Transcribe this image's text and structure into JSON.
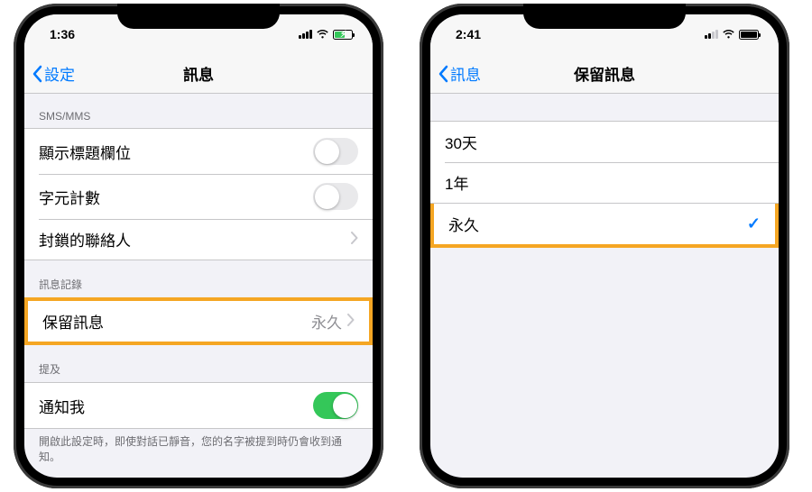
{
  "left": {
    "status_time": "1:36",
    "nav_back": "設定",
    "nav_title": "訊息",
    "sec1_header": "SMS/MMS",
    "row_subject": "顯示標題欄位",
    "row_charcount": "字元計數",
    "row_blocked": "封鎖的聯絡人",
    "sec2_header": "訊息記錄",
    "row_keep": "保留訊息",
    "row_keep_value": "永久",
    "sec3_header": "提及",
    "row_notify": "通知我",
    "sec3_footer": "開啟此設定時，即使對話已靜音，您的名字被提到時仍會收到通知。"
  },
  "right": {
    "status_time": "2:41",
    "nav_back": "訊息",
    "nav_title": "保留訊息",
    "opt_30d": "30天",
    "opt_1y": "1年",
    "opt_forever": "永久"
  }
}
